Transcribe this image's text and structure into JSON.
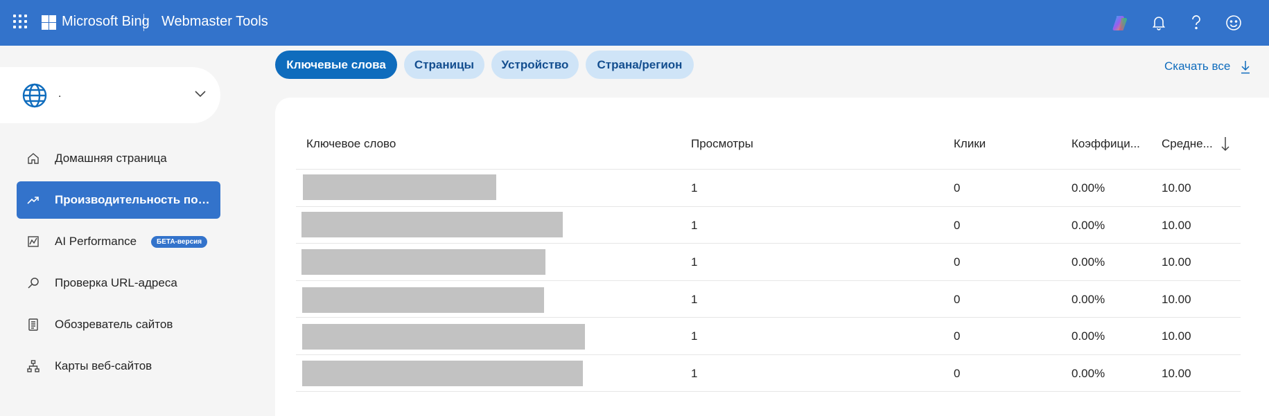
{
  "header": {
    "brand": "Microsoft Bing",
    "product": "Webmaster Tools",
    "icons": [
      "waffle-icon",
      "copilot-icon",
      "bell-icon",
      "help-icon",
      "smiley-icon"
    ]
  },
  "sidebar": {
    "site": {
      "name": "."
    },
    "items": [
      {
        "label": "Домашняя страница",
        "icon": "home-icon"
      },
      {
        "label": "Производительность поиска",
        "icon": "trend-up-icon",
        "active": true
      },
      {
        "label": "AI Performance",
        "icon": "ai-chart-icon",
        "badge": "БЕТА-версия"
      },
      {
        "label": "Проверка URL-адреса",
        "icon": "search-icon"
      },
      {
        "label": "Обозреватель сайтов",
        "icon": "site-list-icon"
      },
      {
        "label": "Карты веб-сайтов",
        "icon": "sitemap-icon"
      }
    ]
  },
  "tabs": [
    {
      "label": "Ключевые слова",
      "active": true
    },
    {
      "label": "Страницы"
    },
    {
      "label": "Устройство"
    },
    {
      "label": "Страна/регион"
    }
  ],
  "download_label": "Скачать все",
  "table": {
    "columns": [
      "Ключевое слово",
      "Просмотры",
      "Клики",
      "Коэффици...",
      "Средне..."
    ],
    "rows": [
      {
        "impressions": "1",
        "clicks": "0",
        "ctr": "0.00%",
        "avg": "10.00"
      },
      {
        "impressions": "1",
        "clicks": "0",
        "ctr": "0.00%",
        "avg": "10.00"
      },
      {
        "impressions": "1",
        "clicks": "0",
        "ctr": "0.00%",
        "avg": "10.00"
      },
      {
        "impressions": "1",
        "clicks": "0",
        "ctr": "0.00%",
        "avg": "10.00"
      },
      {
        "impressions": "1",
        "clicks": "0",
        "ctr": "0.00%",
        "avg": "10.00"
      },
      {
        "impressions": "1",
        "clicks": "0",
        "ctr": "0.00%",
        "avg": "10.00"
      }
    ]
  },
  "colors": {
    "header_bg": "#3373cb",
    "tab_active": "#0f6cbd",
    "tab_inactive": "#cfe4f7",
    "redaction": "#c2c2c2"
  }
}
